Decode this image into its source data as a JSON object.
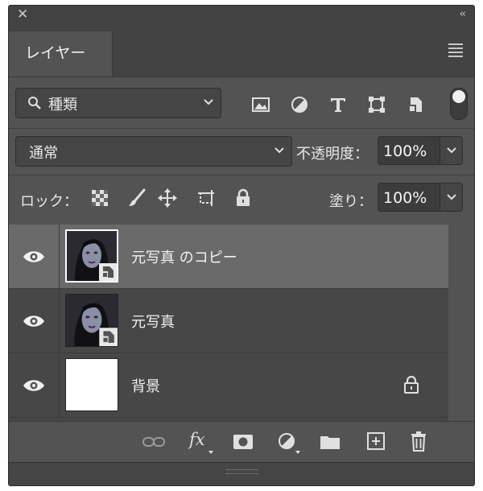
{
  "panel": {
    "tab_label": "レイヤー"
  },
  "filter": {
    "kind_label": "種類",
    "icons": [
      "image-filter-icon",
      "adjustment-filter-icon",
      "type-filter-icon",
      "shape-filter-icon",
      "smart-object-filter-icon"
    ]
  },
  "blend": {
    "mode_label": "通常",
    "opacity_label": "不透明度：",
    "opacity_value": "100%"
  },
  "lock": {
    "label": "ロック：",
    "fill_label": "塗り：",
    "fill_value": "100%"
  },
  "layers": [
    {
      "name": "元写真 のコピー",
      "selected": true,
      "thumb": "portrait-smart"
    },
    {
      "name": "元写真",
      "selected": false,
      "thumb": "portrait-smart"
    },
    {
      "name": "背景",
      "selected": false,
      "thumb": "white",
      "locked": true
    }
  ],
  "bottom_icons": [
    "link-icon",
    "fx-icon",
    "mask-icon",
    "adjustment-icon",
    "folder-icon",
    "new-layer-icon",
    "trash-icon"
  ],
  "colors": {
    "panel_bg": "#535353",
    "selected_row": "#6a6a6a"
  }
}
